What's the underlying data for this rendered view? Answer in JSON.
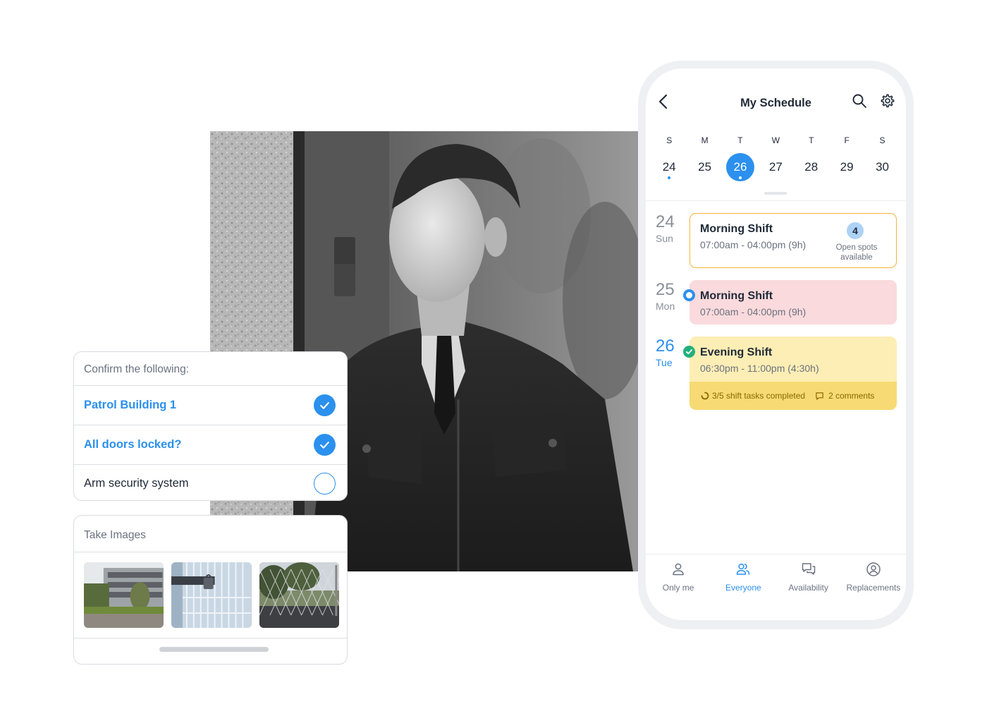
{
  "checklist": {
    "heading": "Confirm the following:",
    "items": [
      {
        "label": "Patrol Building 1",
        "checked": true
      },
      {
        "label": "All doors locked?",
        "checked": true
      },
      {
        "label": "Arm security system",
        "checked": false
      }
    ]
  },
  "images_card": {
    "heading": "Take Images",
    "thumbnails": [
      "building-photo",
      "locked-gate-photo",
      "fence-photo"
    ]
  },
  "schedule": {
    "title": "My Schedule",
    "week": [
      {
        "letter": "S",
        "date": "24",
        "dot": true,
        "selected": false
      },
      {
        "letter": "M",
        "date": "25",
        "dot": false,
        "selected": false
      },
      {
        "letter": "T",
        "date": "26",
        "dot": true,
        "selected": true
      },
      {
        "letter": "W",
        "date": "27",
        "dot": false,
        "selected": false
      },
      {
        "letter": "T",
        "date": "28",
        "dot": false,
        "selected": false
      },
      {
        "letter": "F",
        "date": "29",
        "dot": false,
        "selected": false
      },
      {
        "letter": "S",
        "date": "30",
        "dot": false,
        "selected": false
      }
    ],
    "days": [
      {
        "num": "24",
        "weekday": "Sun",
        "shift": {
          "name": "Morning Shift",
          "time": "07:00am - 04:00pm (9h)",
          "open_spots": "4",
          "open_label": "Open spots available"
        }
      },
      {
        "num": "25",
        "weekday": "Mon",
        "shift": {
          "name": "Morning Shift",
          "time": "07:00am - 04:00pm (9h)"
        }
      },
      {
        "num": "26",
        "weekday": "Tue",
        "shift": {
          "name": "Evening Shift",
          "time": "06:30pm - 11:00pm (4:30h)",
          "tasks": "3/5 shift tasks completed",
          "comments": "2 comments"
        }
      }
    ],
    "tabs": [
      {
        "label": "Only me",
        "icon": "person-icon",
        "active": false
      },
      {
        "label": "Everyone",
        "icon": "people-icon",
        "active": true
      },
      {
        "label": "Availability",
        "icon": "chat-bubbles-icon",
        "active": false
      },
      {
        "label": "Replacements",
        "icon": "user-circle-icon",
        "active": false
      }
    ]
  },
  "colors": {
    "accent": "#2b90ee",
    "open_shift_border": "#f3b43a",
    "pink_shift": "#fadadc",
    "yellow_shift": "#fdeeb5",
    "yellow_footer": "#f7da73",
    "success": "#22b07d"
  }
}
